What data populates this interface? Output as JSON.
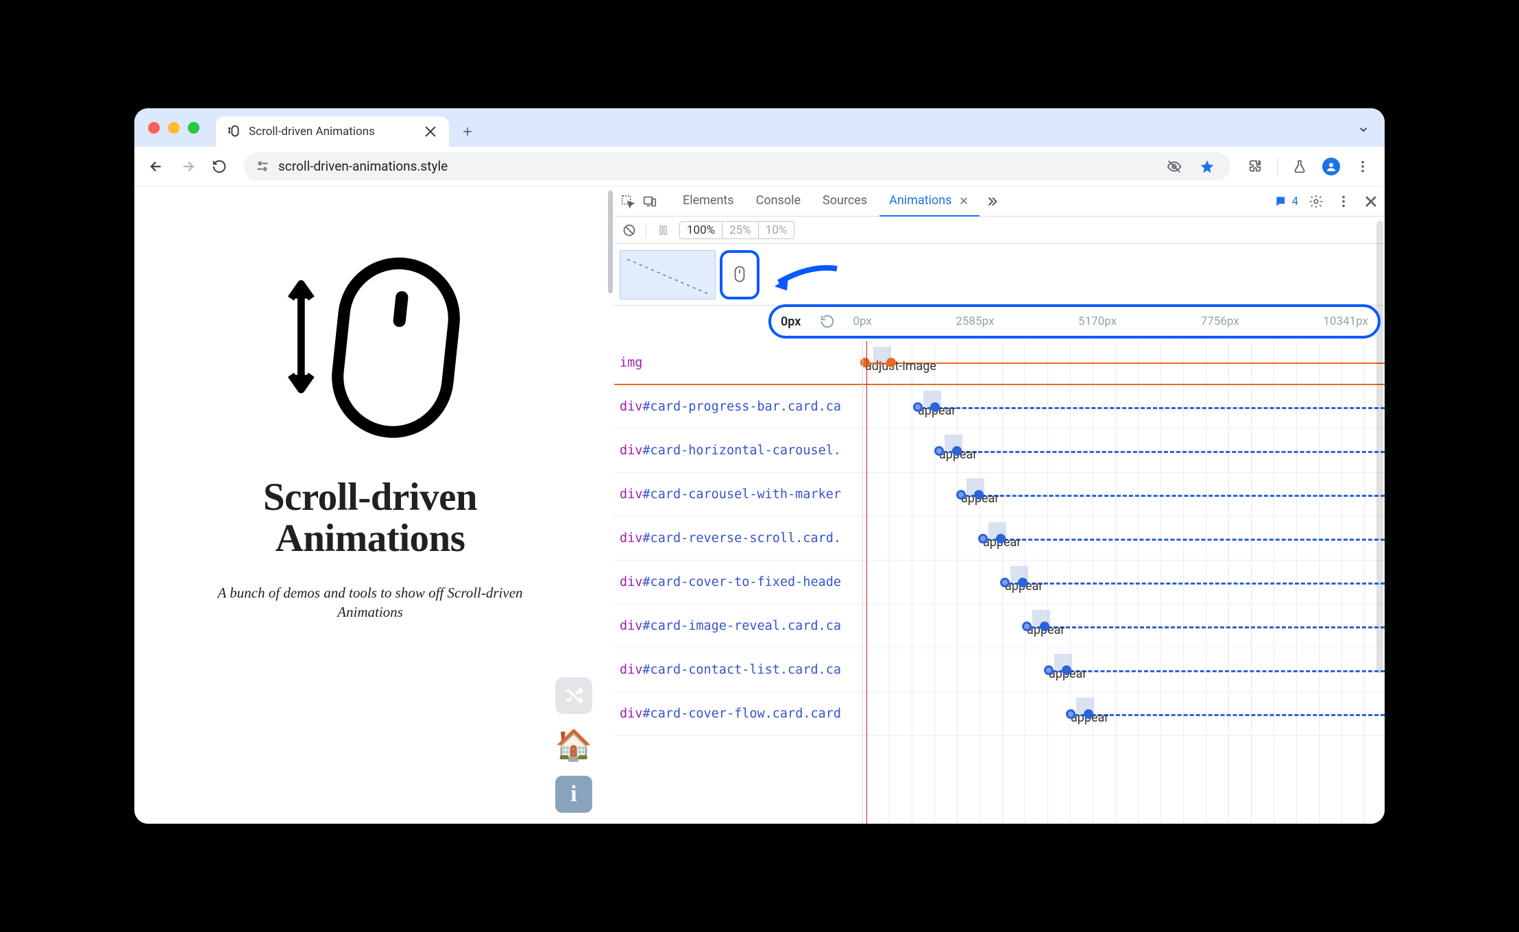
{
  "window": {
    "tab_title": "Scroll-driven Animations",
    "url": "scroll-driven-animations.style"
  },
  "page": {
    "title_line1": "Scroll-driven",
    "title_line2": "Animations",
    "subtitle": "A bunch of demos and tools to show off Scroll-driven Animations",
    "home_emoji": "🏠",
    "info_label": "i"
  },
  "devtools": {
    "tabs": [
      "Elements",
      "Console",
      "Sources",
      "Animations"
    ],
    "active_tab": "Animations",
    "issue_count": "4",
    "speeds": [
      "100%",
      "25%",
      "10%"
    ],
    "active_speed": "100%",
    "scroll_position": "0px",
    "ruler_ticks": [
      "0px",
      "2585px",
      "5170px",
      "7756px",
      "10341px"
    ],
    "rows": [
      {
        "tag": "img",
        "id": "",
        "cls": "",
        "anim": "adjust-image",
        "style": "orange",
        "start": 0,
        "end": 46
      },
      {
        "tag": "div",
        "id": "#card-progress-bar",
        "cls": ".card.ca",
        "anim": "appear",
        "style": "blue",
        "start": 77,
        "end": 110
      },
      {
        "tag": "div",
        "id": "#card-horizontal-carousel",
        "cls": ".",
        "anim": "appear",
        "style": "blue",
        "start": 108,
        "end": 142
      },
      {
        "tag": "div",
        "id": "#card-carousel-with-marker",
        "cls": "",
        "anim": "appear",
        "style": "blue",
        "start": 140,
        "end": 174
      },
      {
        "tag": "div",
        "id": "#card-reverse-scroll",
        "cls": ".card.",
        "anim": "appear",
        "style": "blue",
        "start": 172,
        "end": 206
      },
      {
        "tag": "div",
        "id": "#card-cover-to-fixed-heade",
        "cls": "",
        "anim": "appear",
        "style": "blue",
        "start": 204,
        "end": 238
      },
      {
        "tag": "div",
        "id": "#card-image-reveal",
        "cls": ".card.ca",
        "anim": "appear",
        "style": "blue",
        "start": 236,
        "end": 270
      },
      {
        "tag": "div",
        "id": "#card-contact-list",
        "cls": ".card.ca",
        "anim": "appear",
        "style": "blue",
        "start": 268,
        "end": 302
      },
      {
        "tag": "div",
        "id": "#card-cover-flow",
        "cls": ".card.card",
        "anim": "appear",
        "style": "blue",
        "start": 300,
        "end": 334
      }
    ]
  }
}
